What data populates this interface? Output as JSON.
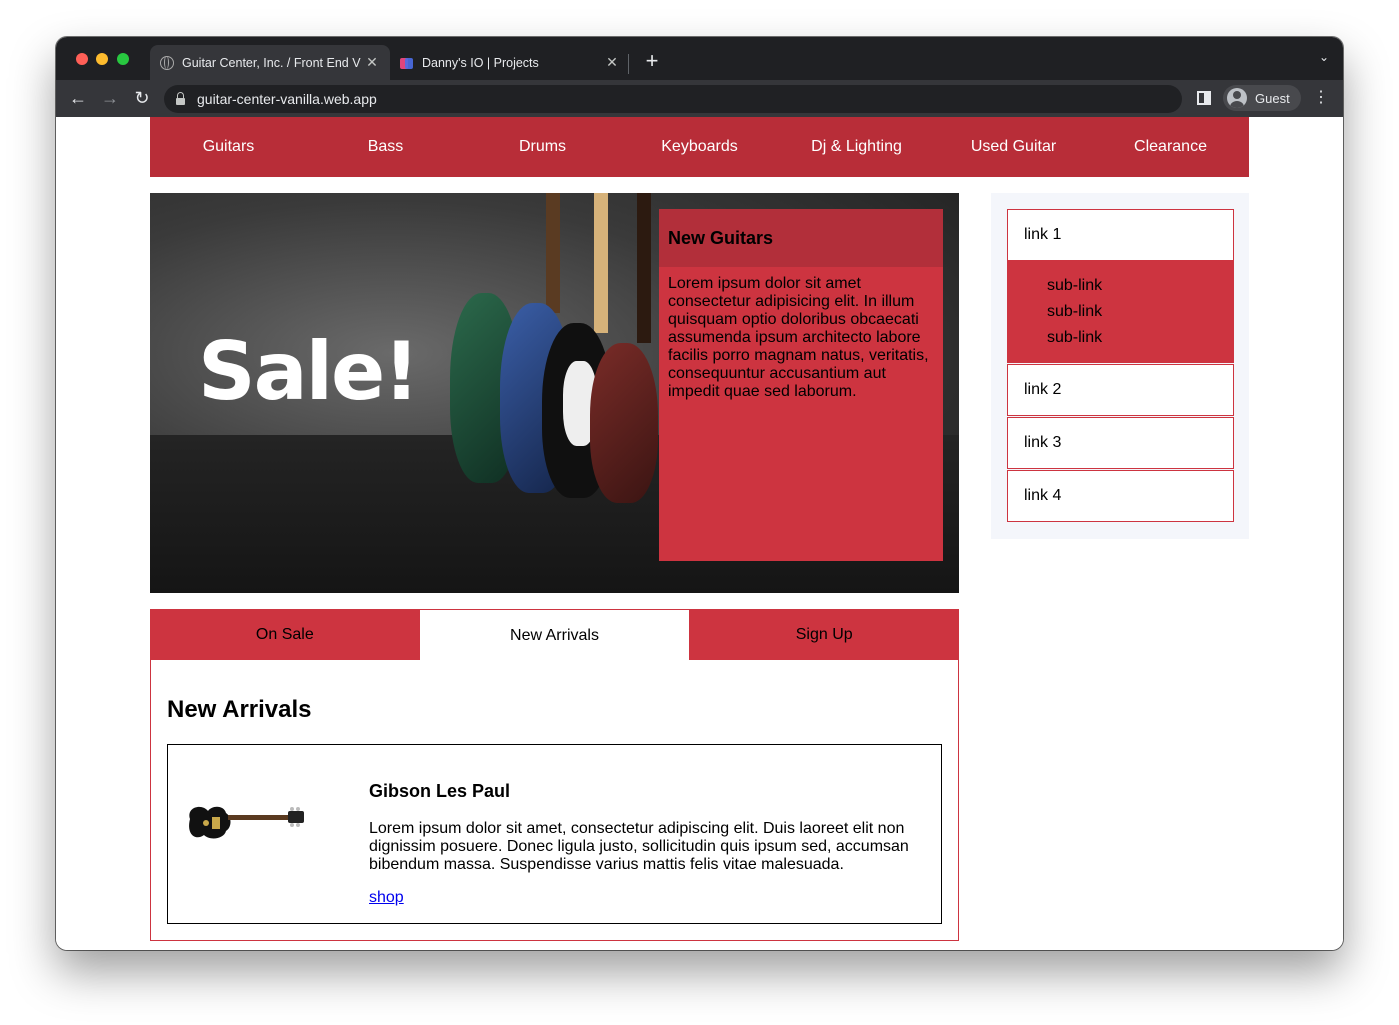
{
  "browser": {
    "tabs": [
      {
        "title": "Guitar Center, Inc. / Front End V",
        "active": true
      },
      {
        "title": "Danny's IO | Projects",
        "active": false
      }
    ],
    "url": "guitar-center-vanilla.web.app",
    "profile": "Guest"
  },
  "nav": {
    "items": [
      "Guitars",
      "Bass",
      "Drums",
      "Keyboards",
      "Dj & Lighting",
      "Used Guitar",
      "Clearance"
    ]
  },
  "hero": {
    "banner_text": "Sale!",
    "card_title": "New Guitars",
    "card_body": "Lorem ipsum dolor sit amet consectetur adipisicing elit. In illum quisquam optio doloribus obcaecati assumenda ipsum architecto labore facilis porro magnam natus, veritatis, consequuntur accusantium aut impedit quae sed laborum."
  },
  "tabs": {
    "items": [
      "On Sale",
      "New Arrivals",
      "Sign Up"
    ],
    "selected": "New Arrivals"
  },
  "panel": {
    "heading": "New Arrivals",
    "product": {
      "title": "Gibson Les Paul",
      "description": "Lorem ipsum dolor sit amet, consectetur adipiscing elit. Duis laoreet elit non dignissim posuere. Donec ligula justo, sollicitudin quis ipsum sed, accumsan bibendum massa. Suspendisse varius mattis felis vitae malesuada.",
      "link": "shop"
    }
  },
  "sidebar": {
    "links": [
      "link 1",
      "link 2",
      "link 3",
      "link 4"
    ],
    "sublinks": [
      "sub-link",
      "sub-link",
      "sub-link"
    ]
  },
  "colors": {
    "nav_red": "#b82d38",
    "accent_red": "#cd3440",
    "card_head_red": "#b22f3a",
    "sidebar_bg": "#f4f6fb"
  }
}
